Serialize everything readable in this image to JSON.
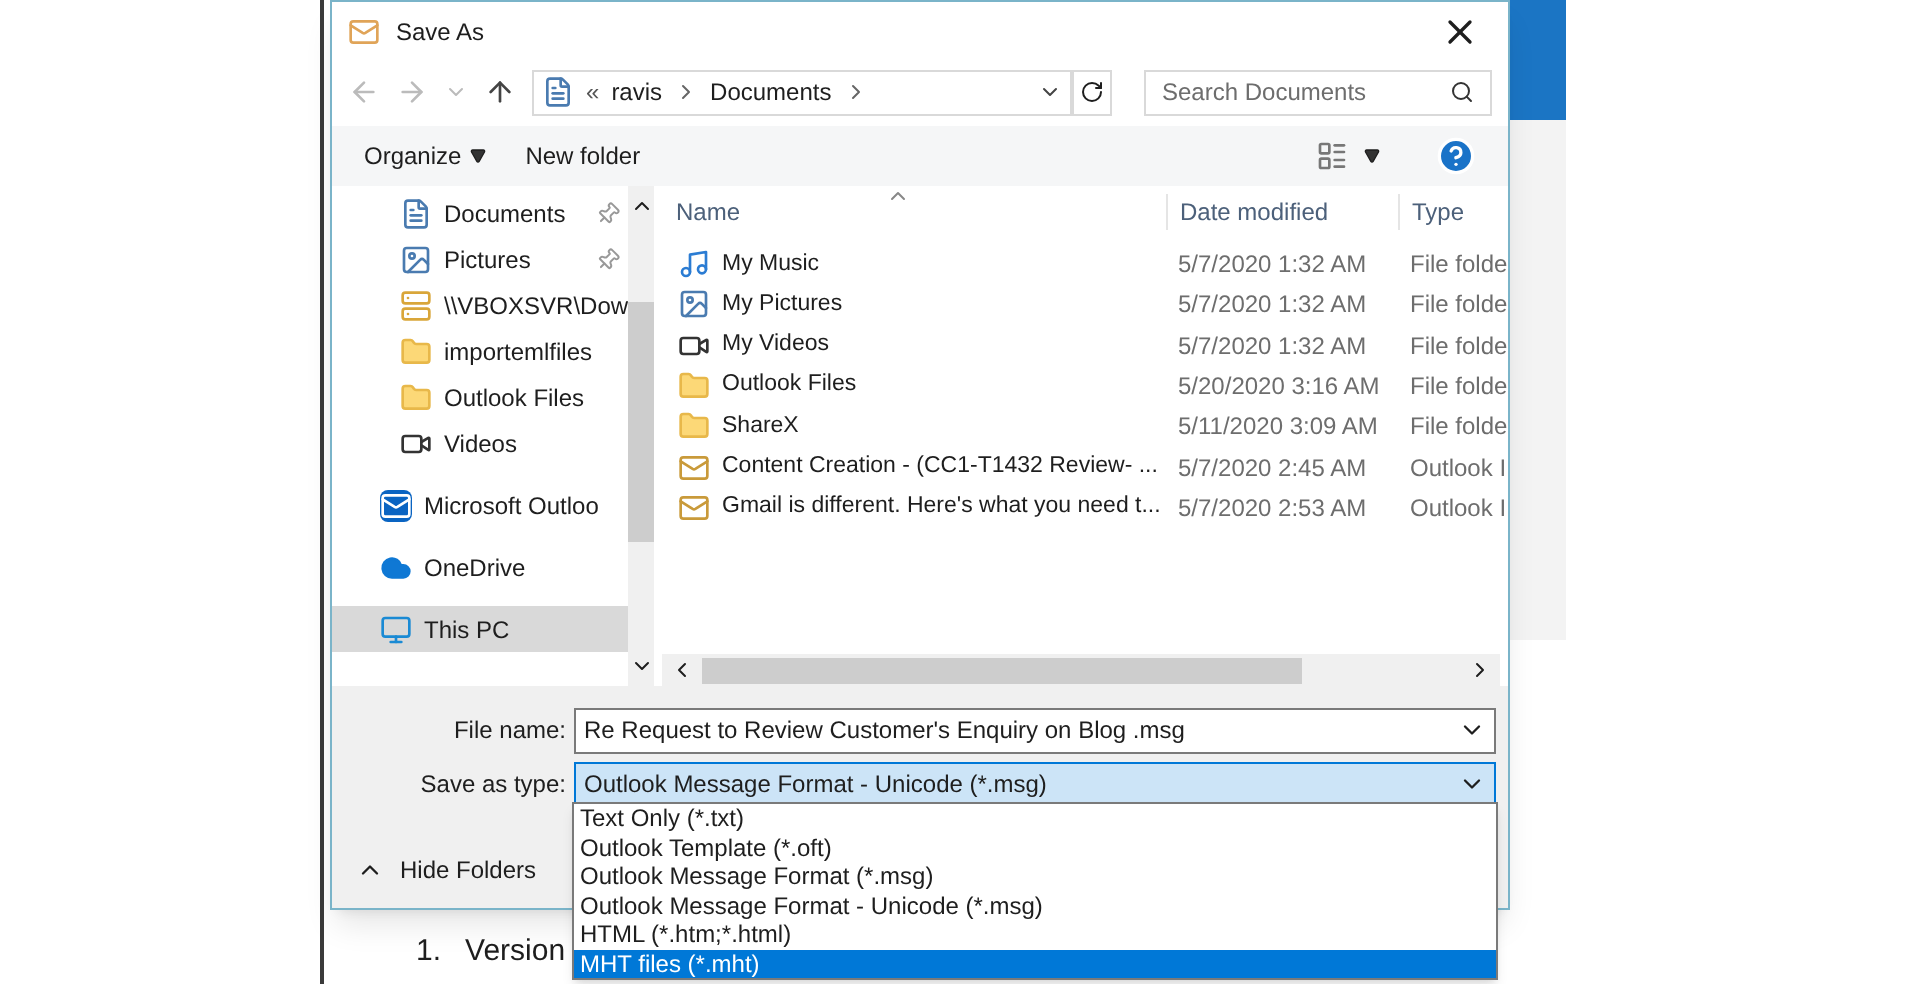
{
  "window": {
    "title": "Save As"
  },
  "nav": {
    "overflow": "«",
    "path": [
      "ravis",
      "Documents"
    ]
  },
  "search": {
    "placeholder": "Search Documents"
  },
  "toolbar": {
    "organize": "Organize",
    "new_folder": "New folder"
  },
  "sidebar": {
    "items": [
      {
        "label": "Documents",
        "kind": "document",
        "pinned": true,
        "selected": false
      },
      {
        "label": "Pictures",
        "kind": "picture",
        "pinned": true,
        "selected": false
      },
      {
        "label": "\\\\VBOXSVR\\Dow",
        "kind": "share",
        "pinned": false,
        "selected": false
      },
      {
        "label": "importemlfiles",
        "kind": "folder",
        "pinned": false,
        "selected": false
      },
      {
        "label": "Outlook Files",
        "kind": "folder",
        "pinned": false,
        "selected": false
      },
      {
        "label": "Videos",
        "kind": "video",
        "pinned": false,
        "selected": false
      },
      {
        "label": "Microsoft Outloo",
        "kind": "outlook",
        "pinned": false,
        "selected": false
      },
      {
        "label": "OneDrive",
        "kind": "cloud",
        "pinned": false,
        "selected": false
      },
      {
        "label": "This PC",
        "kind": "pc",
        "pinned": false,
        "selected": true
      }
    ]
  },
  "table": {
    "columns": [
      "Name",
      "Date modified",
      "Type"
    ],
    "rows": [
      {
        "name": "My Music",
        "date": "5/7/2020 1:32 AM",
        "type": "File folde",
        "kind": "music"
      },
      {
        "name": "My Pictures",
        "date": "5/7/2020 1:32 AM",
        "type": "File folde",
        "kind": "picture"
      },
      {
        "name": "My Videos",
        "date": "5/7/2020 1:32 AM",
        "type": "File folde",
        "kind": "video"
      },
      {
        "name": "Outlook Files",
        "date": "5/20/2020 3:16 AM",
        "type": "File folde",
        "kind": "folder"
      },
      {
        "name": "ShareX",
        "date": "5/11/2020 3:09 AM",
        "type": "File folde",
        "kind": "folder"
      },
      {
        "name": "Content Creation  - (CC1-T1432 Review- ...",
        "date": "5/7/2020 2:45 AM",
        "type": "Outlook I",
        "kind": "mail"
      },
      {
        "name": "Gmail is different. Here's what you need t...",
        "date": "5/7/2020 2:53 AM",
        "type": "Outlook I",
        "kind": "mail"
      }
    ]
  },
  "form": {
    "file_name_label": "File name:",
    "file_name": "Re Request to Review Customer's Enquiry on Blog .msg",
    "type_label": "Save as type:",
    "type_value": "Outlook Message Format - Unicode (*.msg)",
    "hide_folders": "Hide Folders"
  },
  "type_options": [
    {
      "label": "Text Only (*.txt)",
      "selected": false
    },
    {
      "label": "Outlook Template (*.oft)",
      "selected": false
    },
    {
      "label": "Outlook Message Format (*.msg)",
      "selected": false
    },
    {
      "label": "Outlook Message Format - Unicode (*.msg)",
      "selected": false
    },
    {
      "label": "HTML (*.htm;*.html)",
      "selected": false
    },
    {
      "label": "MHT files (*.mht)",
      "selected": true
    }
  ],
  "background_doc": {
    "number": "1.",
    "text": "Version"
  }
}
